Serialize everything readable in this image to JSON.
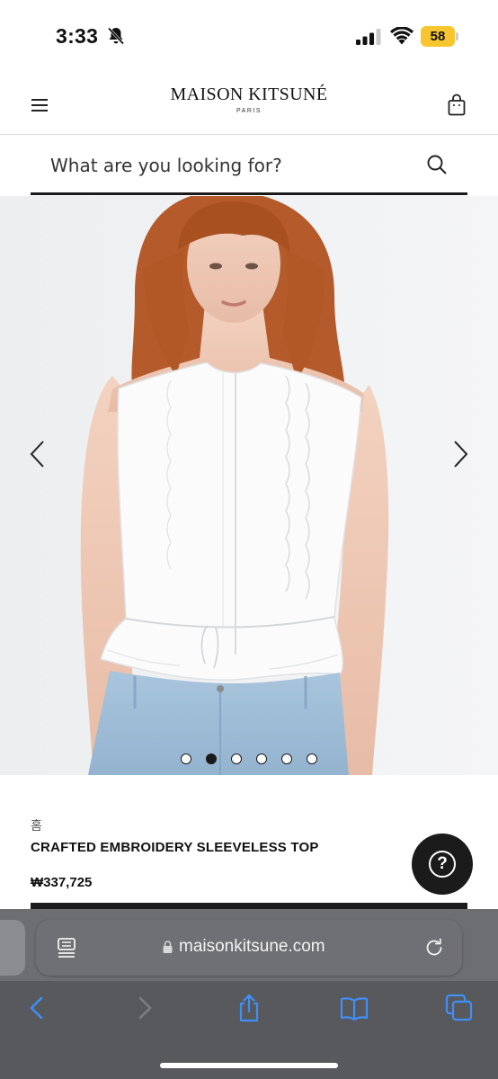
{
  "status_bar": {
    "time": "3:33",
    "battery": "58",
    "icons": [
      "bell-slash-icon",
      "cellular-signal-icon",
      "wifi-icon",
      "battery-icon"
    ]
  },
  "header": {
    "brand_name": "MAISON KITSUNÉ",
    "brand_sub": "PARIS",
    "menu_icon": "hamburger-menu-icon",
    "bag_icon": "shopping-bag-icon"
  },
  "search": {
    "placeholder": "What are you looking for?",
    "icon": "search-icon"
  },
  "gallery": {
    "image_subject": "product-photo-white-sleeveless-top",
    "slide_count": 6,
    "active_slide": 2,
    "prev_icon": "chevron-left-icon",
    "next_icon": "chevron-right-icon"
  },
  "product": {
    "breadcrumb": "홈",
    "title": "CRAFTED EMBROIDERY SLEEVELESS TOP",
    "price": "₩337,725",
    "help_label": "?"
  },
  "browser": {
    "url": "maisonkitsune.com",
    "icons": [
      "reader-mode-icon",
      "lock-icon",
      "reload-icon",
      "back-icon",
      "forward-icon",
      "share-icon",
      "bookmarks-icon",
      "tabs-icon"
    ]
  },
  "colors": {
    "text_primary": "#111111",
    "accent_dark": "#1a1a1a",
    "battery_yellow": "#f7c62e",
    "safari_blue": "#3f8ff7",
    "safari_toolbar": "#58595d"
  }
}
